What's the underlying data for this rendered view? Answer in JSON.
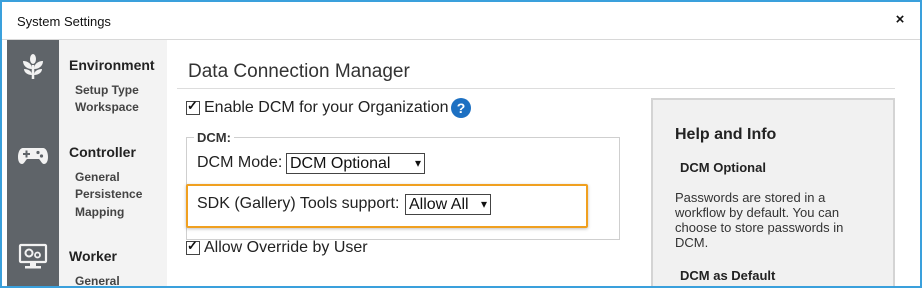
{
  "window": {
    "title": "System Settings",
    "close_glyph": "×"
  },
  "iconbar": {
    "icons": [
      "plant-icon",
      "gamepad-icon",
      "monitor-gears-icon"
    ]
  },
  "nav": {
    "environment": {
      "label": "Environment",
      "items": [
        "Setup Type",
        "Workspace"
      ]
    },
    "controller": {
      "label": "Controller",
      "items": [
        "General",
        "Persistence",
        "Mapping"
      ]
    },
    "worker": {
      "label": "Worker",
      "items": [
        "General"
      ]
    }
  },
  "main": {
    "title": "Data Connection Manager",
    "enable_dcm": {
      "label": "Enable DCM for your Organization",
      "checked": true
    },
    "help_icon": "?",
    "dcm_group": {
      "legend": "DCM:",
      "mode": {
        "label": "DCM Mode:",
        "value": "DCM Optional"
      },
      "sdk": {
        "label": "SDK (Gallery) Tools support:",
        "value": "Allow All"
      }
    },
    "allow_override": {
      "label": "Allow Override by User",
      "checked": true
    }
  },
  "help": {
    "title": "Help and Info",
    "section1_title": "DCM Optional",
    "section1_text": "Passwords are stored in a workflow by default. You can choose to store passwords in DCM.",
    "section2_title": "DCM as Default"
  },
  "colors": {
    "frame_border": "#3aa0dc",
    "iconbar_bg": "#5f6469",
    "highlight": "#f0a020",
    "help_icon_bg": "#1d70c2"
  }
}
